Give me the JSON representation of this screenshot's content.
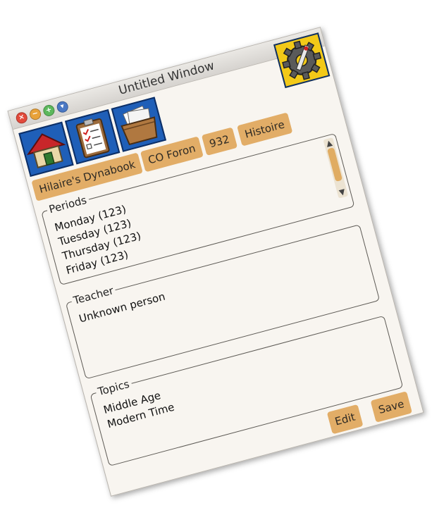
{
  "window": {
    "title": "Untitled Window"
  },
  "toolbar": {
    "home_icon": "home-icon",
    "clipboard_icon": "clipboard-checklist-icon",
    "documents_icon": "document-box-icon",
    "settings_icon": "gear-wrench-icon"
  },
  "breadcrumbs": [
    {
      "label": "Hilaire's Dynabook"
    },
    {
      "label": "CO Foron"
    },
    {
      "label": "932"
    },
    {
      "label": "Histoire"
    }
  ],
  "periods": {
    "legend": "Periods",
    "items": [
      "Monday (123)",
      "Tuesday (123)",
      "Thursday (123)",
      "Friday (123)"
    ]
  },
  "teacher": {
    "legend": "Teacher",
    "value": "Unknown person"
  },
  "topics": {
    "legend": "Topics",
    "items": [
      "Middle Age",
      "Modern Time"
    ]
  },
  "actions": {
    "edit_label": "Edit",
    "save_label": "Save"
  },
  "colors": {
    "button_bg": "#e2ad67",
    "toolbar_icon_bg": "#1f5fb8",
    "settings_bg": "#f2c918",
    "window_bg": "#f8f5f0"
  }
}
